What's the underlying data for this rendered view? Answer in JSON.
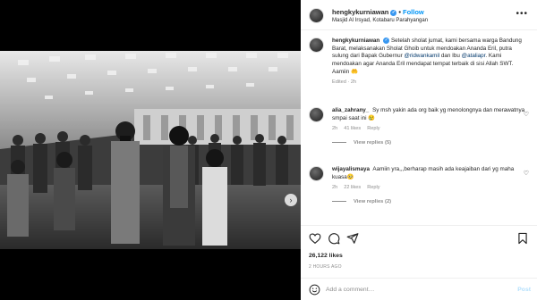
{
  "post": {
    "username": "hengkykurniawan",
    "separator": "•",
    "follow_label": "Follow",
    "location": "Masjid Al Irsyad, Kotabaru Parahyangan",
    "more_glyph": "•••"
  },
  "caption": {
    "username": "hengkykurniawan",
    "text_1": "Setelah sholat jumat, kami bersama warga Bandung Barat, melaksanakan Sholat Ghoib untuk mendoakan Ananda Eril, putra sulung dari Bapak Gubernur ",
    "mention_1": "@ridwankamil",
    "text_2": " dan Ibu ",
    "mention_2": "@ataliapr",
    "text_3": ". Kami mendoakan agar Ananda Eril mendapat tempat terbaik di sisi Allah SWT. Aamiin 🤲",
    "meta": "Edited · 2h"
  },
  "comments": [
    {
      "username": "alia_zahrany_",
      "text": "Sy msh yakin ada org baik yg menolongnya dan merawatnya smpai saat ini 😢",
      "time": "2h",
      "likes": "41 likes",
      "reply": "Reply",
      "view_replies": "View replies (5)"
    },
    {
      "username": "wijayalismaya",
      "text": "Aamiin yra,,,berharap masih ada keajaiban dari yg maha kuasa🥺",
      "time": "2h",
      "likes": "22 likes",
      "reply": "Reply",
      "view_replies": "View replies (2)"
    }
  ],
  "likes_count": "26,122 likes",
  "timestamp": "2 HOURS AGO",
  "add_comment": {
    "placeholder": "Add a comment…",
    "post_label": "Post"
  },
  "icons": {
    "heart": "heart-icon",
    "comment": "comment-icon",
    "share": "share-icon",
    "save": "bookmark-icon",
    "emoji": "emoji-icon",
    "next": "chevron-right-icon",
    "tag": "user-tag-icon"
  },
  "colors": {
    "accent": "#0095f6",
    "mention": "#00376b",
    "muted": "#8e8e8e",
    "verified": "#3897f0"
  }
}
